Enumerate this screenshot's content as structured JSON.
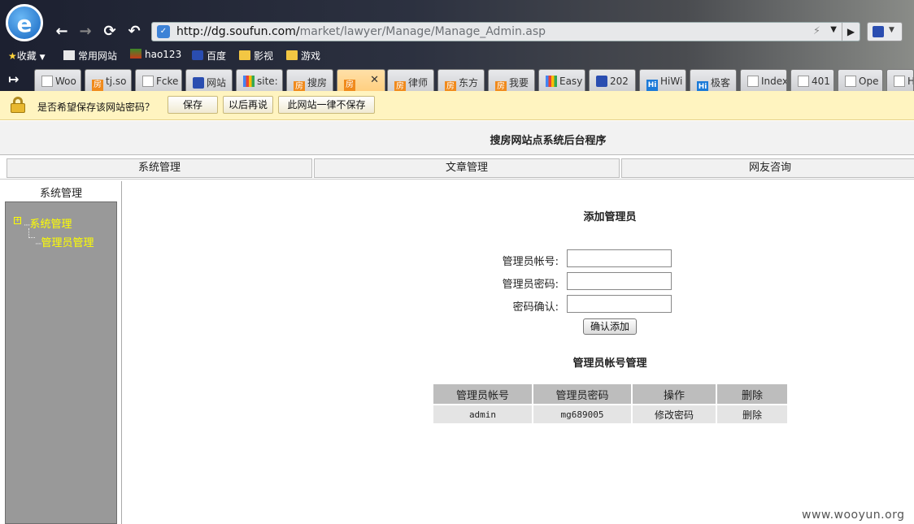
{
  "browser": {
    "url_host": "http://dg.soufun.com/",
    "url_path": "market/lawyer/Manage/Manage_Admin.asp",
    "bookmarks": [
      {
        "label": "收藏",
        "icon": "star-icon"
      },
      {
        "label": "常用网站",
        "icon": "sites-icon"
      },
      {
        "label": "hao123",
        "icon": "hao123-icon"
      },
      {
        "label": "百度",
        "icon": "baidu-icon"
      },
      {
        "label": "影视",
        "icon": "folder-icon"
      },
      {
        "label": "游戏",
        "icon": "folder-icon"
      }
    ],
    "tabs": [
      {
        "label": "Woo",
        "icon": "page-icon"
      },
      {
        "label": "tj.so",
        "icon": "fang-icon"
      },
      {
        "label": "Fcke",
        "icon": "page-icon"
      },
      {
        "label": "网站",
        "icon": "baidu-icon"
      },
      {
        "label": "site:",
        "icon": "google-icon"
      },
      {
        "label": "搜房",
        "icon": "fang-icon"
      },
      {
        "label": "",
        "icon": "fang-icon",
        "active": true
      },
      {
        "label": "律师",
        "icon": "fang-icon"
      },
      {
        "label": "东方",
        "icon": "fang-icon"
      },
      {
        "label": "我要",
        "icon": "fang-icon"
      },
      {
        "label": "Easy",
        "icon": "google-icon"
      },
      {
        "label": "202",
        "icon": "baidu-icon"
      },
      {
        "label": "HiWi",
        "icon": "hi-icon"
      },
      {
        "label": "极客",
        "icon": "hi-icon"
      },
      {
        "label": "Index",
        "icon": "page-icon"
      },
      {
        "label": "401",
        "icon": "page-icon"
      },
      {
        "label": "Ope",
        "icon": "page-icon"
      },
      {
        "label": "H",
        "icon": "page-icon"
      }
    ],
    "password_bar": {
      "message": "是否希望保存该网站密码？",
      "save": "保存",
      "later": "以后再说",
      "never": "此网站一律不保存"
    }
  },
  "page": {
    "title": "搜房网站点系统后台程序",
    "nav": [
      "系统管理",
      "文章管理",
      "网友咨询"
    ],
    "sidebar": {
      "title": "系统管理",
      "tree_root": "系统管理",
      "tree_child": "管理员管理"
    },
    "form": {
      "title": "添加管理员",
      "account_label": "管理员帐号:",
      "password_label": "管理员密码:",
      "confirm_label": "密码确认:",
      "submit": "确认添加"
    },
    "list": {
      "title": "管理员帐号管理",
      "headers": [
        "管理员帐号",
        "管理员密码",
        "操作",
        "删除"
      ],
      "rows": [
        [
          "admin",
          "mg689005",
          "修改密码",
          "删除"
        ]
      ]
    }
  },
  "watermark": "www.wooyun.org"
}
